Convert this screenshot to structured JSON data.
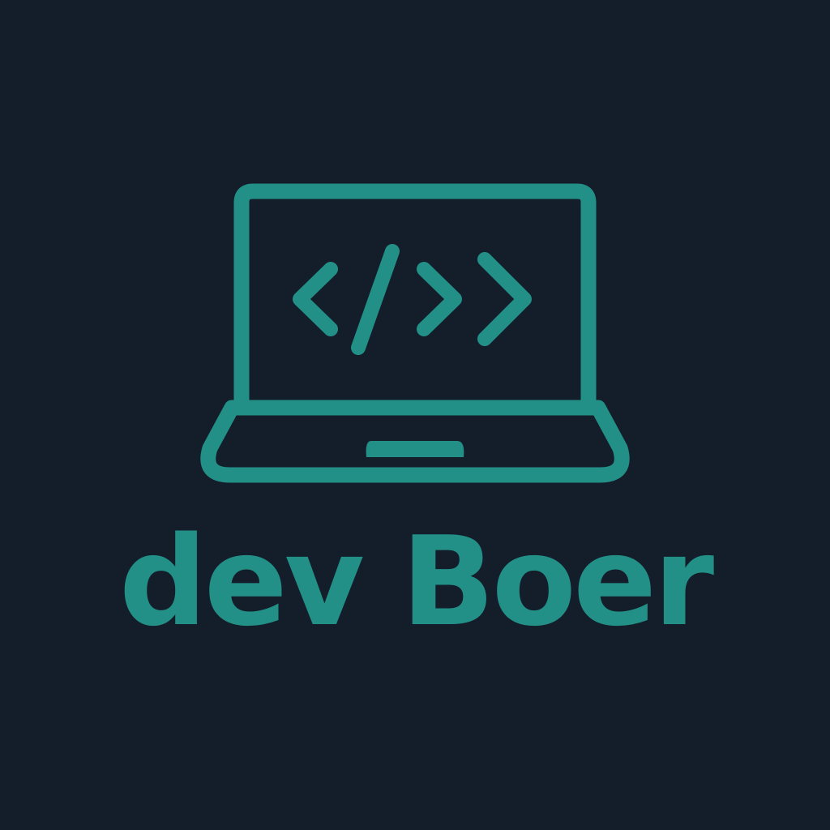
{
  "colors": {
    "background": "#131e2a",
    "accent": "#239088"
  },
  "logo": {
    "icon": "laptop-code-icon",
    "brand_name": "dev Boer"
  }
}
